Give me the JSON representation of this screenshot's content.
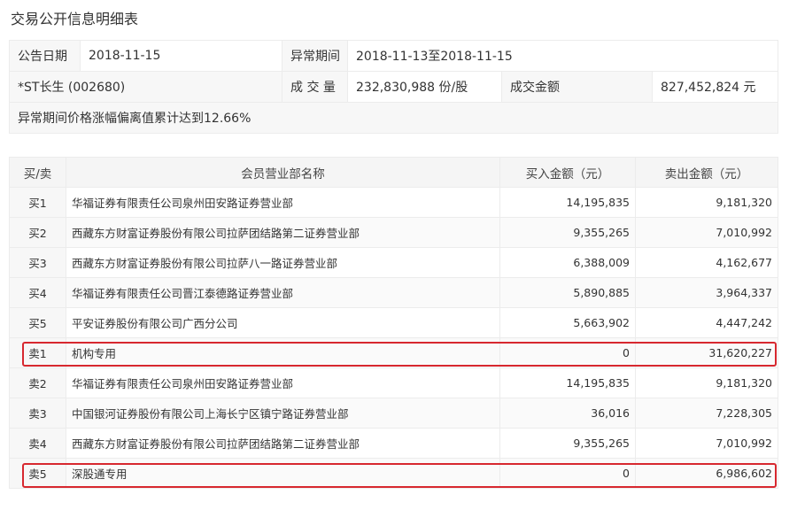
{
  "page_title": "交易公开信息明细表",
  "info": {
    "date_label": "公告日期",
    "date_value": "2018-11-15",
    "period_label": "异常期间",
    "period_value": "2018-11-13至2018-11-15",
    "stock": "*ST长生 (002680)",
    "volume_label": "成 交 量",
    "volume_value": "232,830,988 份/股",
    "amount_label": "成交金额",
    "amount_value": "827,452,824 元",
    "note": "异常期间价格涨幅偏离值累计达到12.66%"
  },
  "table": {
    "headers": [
      "买/卖",
      "会员营业部名称",
      "买入金额（元）",
      "卖出金额（元）"
    ],
    "rows": [
      {
        "side": "买1",
        "name": "华福证券有限责任公司泉州田安路证券营业部",
        "buy": "14,195,835",
        "sell": "9,181,320"
      },
      {
        "side": "买2",
        "name": "西藏东方财富证券股份有限公司拉萨团结路第二证券营业部",
        "buy": "9,355,265",
        "sell": "7,010,992"
      },
      {
        "side": "买3",
        "name": "西藏东方财富证券股份有限公司拉萨八一路证券营业部",
        "buy": "6,388,009",
        "sell": "4,162,677"
      },
      {
        "side": "买4",
        "name": "华福证券有限责任公司晋江泰德路证券营业部",
        "buy": "5,890,885",
        "sell": "3,964,337"
      },
      {
        "side": "买5",
        "name": "平安证券股份有限公司广西分公司",
        "buy": "5,663,902",
        "sell": "4,447,242"
      },
      {
        "side": "卖1",
        "name": "机构专用",
        "buy": "0",
        "sell": "31,620,227"
      },
      {
        "side": "卖2",
        "name": "华福证券有限责任公司泉州田安路证券营业部",
        "buy": "14,195,835",
        "sell": "9,181,320"
      },
      {
        "side": "卖3",
        "name": "中国银河证券股份有限公司上海长宁区镇宁路证券营业部",
        "buy": "36,016",
        "sell": "7,228,305"
      },
      {
        "side": "卖4",
        "name": "西藏东方财富证券股份有限公司拉萨团结路第二证券营业部",
        "buy": "9,355,265",
        "sell": "7,010,992"
      },
      {
        "side": "卖5",
        "name": "深股通专用",
        "buy": "0",
        "sell": "6,986,602"
      }
    ]
  },
  "colors": {
    "highlight": "#d7282f",
    "label_bg": "#f7f7f7",
    "border": "#ececec"
  }
}
